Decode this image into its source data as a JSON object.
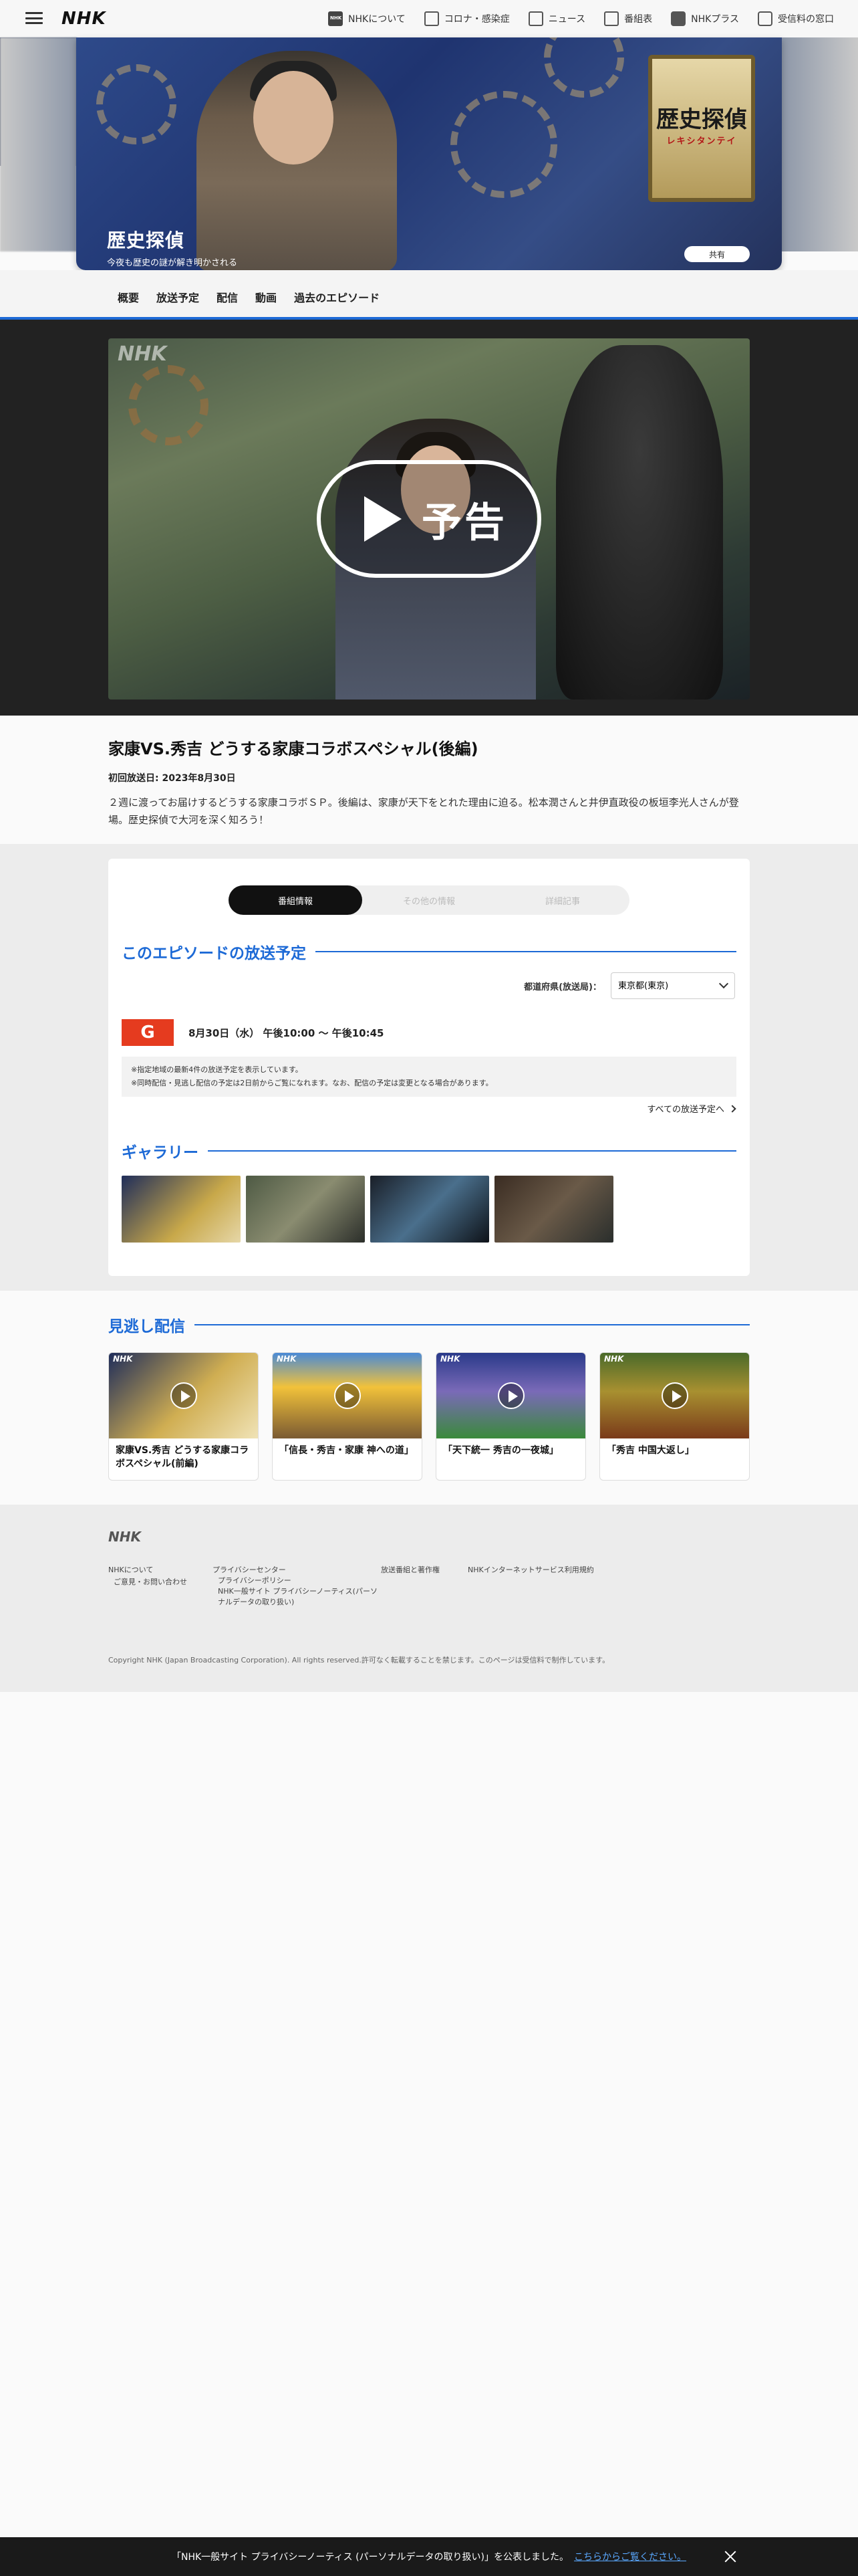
{
  "header": {
    "logo": "NHK",
    "nav": [
      {
        "label": "NHKについて",
        "icon": "nhk-icon"
      },
      {
        "label": "コロナ・感染症",
        "icon": "corona-icon"
      },
      {
        "label": "ニュース",
        "icon": "news-icon"
      },
      {
        "label": "番組表",
        "icon": "program-guide-icon"
      },
      {
        "label": "NHKプラス",
        "icon": "nhk-plus-icon"
      },
      {
        "label": "受信料の窓口",
        "icon": "fee-window-icon"
      }
    ]
  },
  "hero": {
    "emblem_main": "歴史探偵",
    "emblem_sub": "レキシタンテイ",
    "title": "歴史探偵",
    "subtitle": "今夜も歴史の謎が解き明かされる",
    "share_label": "共有"
  },
  "subnav": [
    "概要",
    "放送予定",
    "配信",
    "動画",
    "過去のエピソード"
  ],
  "video": {
    "watermark": "NHK",
    "play_label": "予告"
  },
  "episode": {
    "title": "家康VS.秀吉 どうする家康コラボスペシャル(後編)",
    "first_aired": "初回放送日: 2023年8月30日",
    "description": "２週に渡ってお届けするどうする家康コラボＳＰ。後編は、家康が天下をとれた理由に迫る。松本潤さんと井伊直政役の板垣李光人さんが登場。歴史探偵で大河を深く知ろう！"
  },
  "tabs": [
    {
      "label": "番組情報",
      "active": true
    },
    {
      "label": "その他の情報",
      "active": false
    },
    {
      "label": "詳細記事",
      "active": false
    }
  ],
  "schedule": {
    "heading": "このエピソードの放送予定",
    "region_label": "都道府県(放送局)：",
    "region_value": "東京都(東京)",
    "channel": "G",
    "time": "8月30日（水） 午後10:00 ～ 午後10:45",
    "note1": "※指定地域の最新4件の放送予定を表示しています。",
    "note2": "※同時配信・見逃し配信の予定は2日前からご覧になれます。なお、配信の予定は変更となる場合があります。",
    "all_link": "すべての放送予定へ"
  },
  "gallery": {
    "heading": "ギャラリー",
    "count": 4
  },
  "catchup": {
    "heading": "見逃し配信",
    "items": [
      {
        "title": "家康VS.秀吉 どうする家康コラボスペシャル(前編)"
      },
      {
        "title": "「信長・秀吉・家康 神への道」"
      },
      {
        "title": "「天下統一 秀吉の一夜城」"
      },
      {
        "title": "「秀吉 中国大返し」"
      }
    ]
  },
  "footer": {
    "logo": "NHK",
    "links": {
      "about": "NHKについて",
      "contact": "ご意見・お問い合わせ",
      "privacy_center": "プライバシーセンター",
      "privacy_policy": "プライバシーポリシー",
      "privacy_notice": "NHK一般サイト プライバシーノーティス(パーソナルデータの取り扱い)",
      "broadcast_rights": "放送番組と著作権",
      "terms": "NHKインターネットサービス利用規約"
    },
    "copyright": "Copyright NHK (Japan Broadcasting Corporation). All rights reserved.許可なく転載することを禁じます。このページは受信料で制作しています。"
  },
  "notice": {
    "text": "「NHK一般サイト プライバシーノーティス (パーソナルデータの取り扱い)」を公表しました。",
    "link": "こちらからご覧ください。"
  }
}
